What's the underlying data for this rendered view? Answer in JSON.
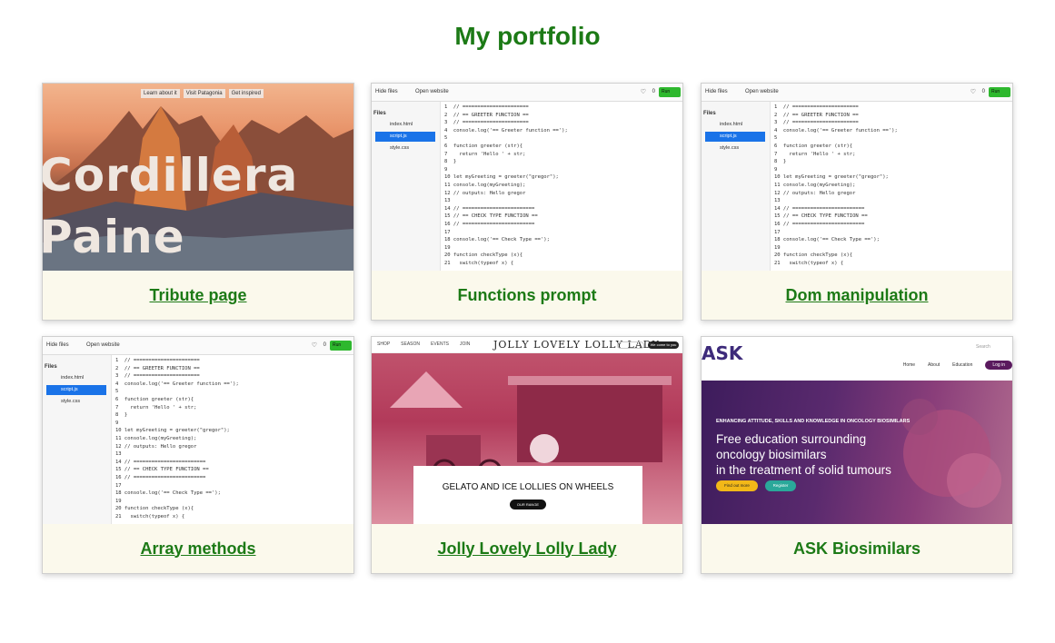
{
  "page": {
    "title": "My portfolio"
  },
  "editor": {
    "hide_files": "Hide files",
    "open_website": "Open website",
    "likes": "0",
    "run": "Run",
    "files_title": "Files",
    "files": [
      "index.html",
      "script.js",
      "style.css"
    ],
    "code_lines": [
      "1  // ======================",
      "2  // == GREETER FUNCTION ==",
      "3  // ======================",
      "4  console.log('== Greeter function ==');",
      "5",
      "6  function greeter (str){",
      "7    return 'Hello ' + str;",
      "8  }",
      "9",
      "10 let myGreeting = greeter(\"gregor\");",
      "11 console.log(myGreeting);",
      "12 // outputs: Hello gregor",
      "13",
      "14 // ========================",
      "15 // == CHECK TYPE FUNCTION ==",
      "16 // ========================",
      "17",
      "18 console.log('== Check Type ==');",
      "19",
      "20 function checkType (x){",
      "21   switch(typeof x) {"
    ]
  },
  "tribute": {
    "nav": [
      "Learn about it",
      "Visit Patagonia",
      "Get inspired"
    ],
    "heading_line1": "Cordillera",
    "heading_line2": "Paine"
  },
  "jolly": {
    "nav": [
      "SHOP",
      "SEASON",
      "EVENTS",
      "JOIN"
    ],
    "logo": "JOLLY LOVELY LOLLY LADY",
    "btn_outline": "",
    "btn_dark": "We come to you",
    "box_heading": "GELATO AND ICE LOLLIES ON WHEELS",
    "box_button": "OUR RANGE"
  },
  "ask": {
    "logo": "ASK",
    "search": "Search",
    "nav": [
      "Home",
      "About",
      "Education"
    ],
    "login": "Log in",
    "kicker": "ENHANCING ATTITUDE, SKILLS AND KNOWLEDGE IN ONCOLOGY BIOSIMILARS",
    "headline": [
      "Free education surrounding",
      "oncology biosimilars",
      "in the treatment of solid tumours"
    ],
    "btn1": "Find out more",
    "btn2": "Register"
  },
  "cards": [
    {
      "caption": "Tribute page"
    },
    {
      "caption": "Functions prompt"
    },
    {
      "caption": "Dom manipulation"
    },
    {
      "caption": "Array methods"
    },
    {
      "caption": "Jolly Lovely Lolly Lady"
    },
    {
      "caption": "ASK Biosimilars"
    }
  ]
}
